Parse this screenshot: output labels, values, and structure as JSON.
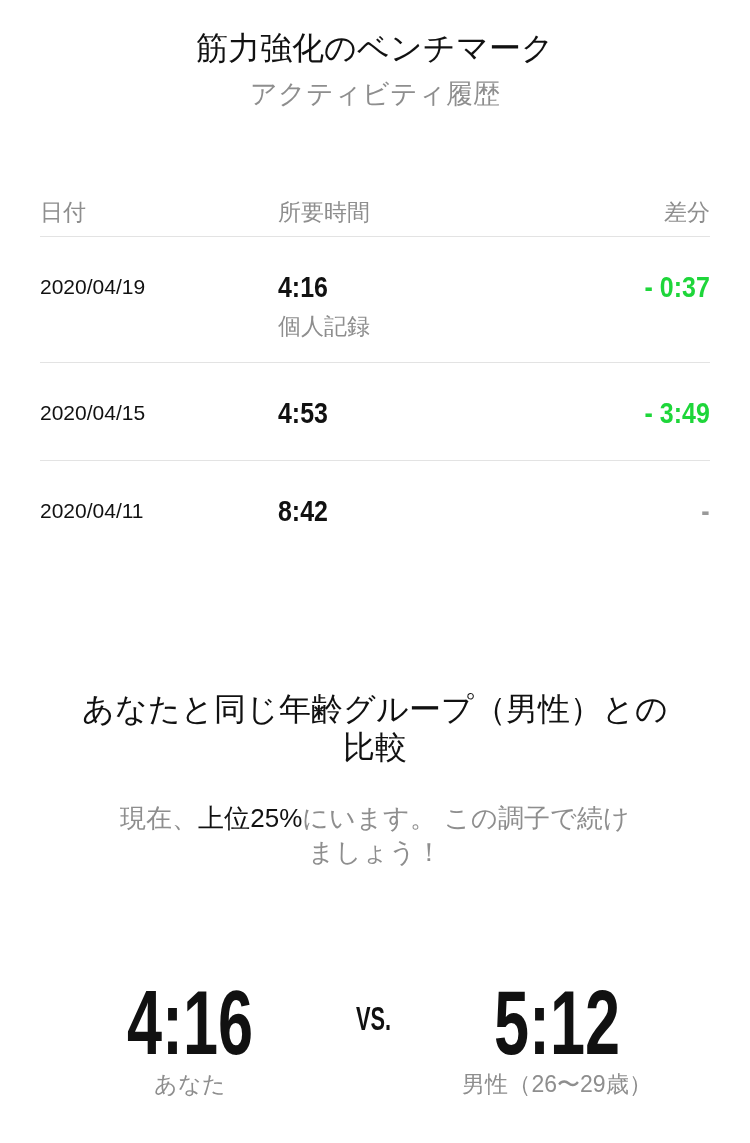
{
  "header": {
    "title": "筋力強化のベンチマーク",
    "subtitle": "アクティビティ履歴"
  },
  "history": {
    "columns": [
      "日付",
      "所要時間",
      "差分"
    ],
    "rows": [
      {
        "date": "2020/04/19",
        "time": "4:16",
        "note": "個人記録",
        "difference": "- 0:37",
        "color": "#1ed63a"
      },
      {
        "date": "2020/04/15",
        "time": "4:53",
        "difference": "- 3:49",
        "color": "#1ed63a"
      },
      {
        "date": "2020/04/11",
        "time": "8:42",
        "difference": "-",
        "color": "#999999"
      }
    ]
  },
  "comparison": {
    "title": "あなたと同じ年齢グループ（男性）との比較",
    "message": "現在、**上位25%**にいます。 この調子で続けましょう！",
    "you": {
      "time": "4:16",
      "label": "あなた"
    },
    "separator": "VS.",
    "group": {
      "time": "5:12",
      "label": "男性（26〜29歳）"
    }
  }
}
